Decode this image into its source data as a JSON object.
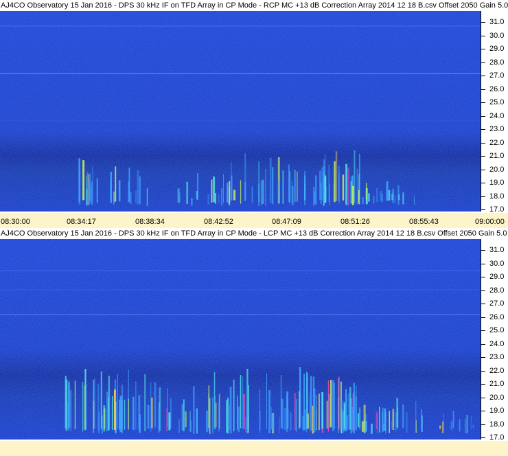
{
  "panels": [
    {
      "title": "AJ4CO Observatory 15 Jan 2016 - DPS 30 kHz IF on TFD Array in CP Mode - RCP  MC +13 dB  Correction Array 2014 12 18 B.csv  Offset 2050  Gain 5.0",
      "y_labels": [
        "31.0",
        "30.0",
        "29.0",
        "28.0",
        "27.0",
        "26.0",
        "25.0",
        "24.0",
        "23.0",
        "22.0",
        "21.0",
        "20.0",
        "19.0",
        "18.0",
        "17.0"
      ]
    },
    {
      "title": "AJ4CO Observatory 15 Jan 2016 - DPS 30 kHz IF on TFD Array in CP Mode - LCP  MC +13 dB  Correction Array 2014 12 18 B.csv  Offset 2050  Gain 5.0",
      "y_labels": [
        "31.0",
        "30.0",
        "29.0",
        "28.0",
        "27.0",
        "26.0",
        "25.0",
        "24.0",
        "23.0",
        "22.0",
        "21.0",
        "20.0",
        "19.0",
        "18.0",
        "17.0"
      ]
    }
  ],
  "time_axis": [
    "08:30:00",
    "08:34:17",
    "08:38:34",
    "08:42:52",
    "08:47:09",
    "08:51:26",
    "08:55:43",
    "09:00:00"
  ],
  "colors": {
    "background_blue": "#1433c8",
    "axis_bar": "#fdf5c9"
  }
}
